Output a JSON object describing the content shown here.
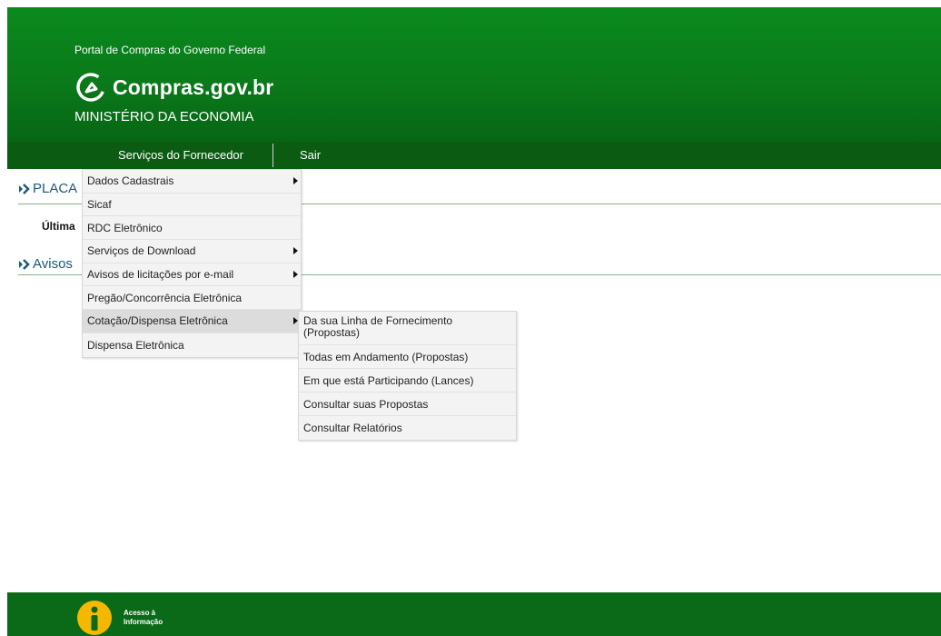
{
  "header": {
    "portal_name": "Portal de Compras do Governo Federal",
    "brand": "Compras.gov.br",
    "ministry": "MINISTÉRIO DA ECONOMIA",
    "logo_icon": "compras-logo-icon"
  },
  "nav": {
    "services": "Serviços do Fornecedor",
    "exit": "Sair"
  },
  "sections": {
    "placa": "PLACA",
    "ultima": "Última",
    "avisos": "Avisos"
  },
  "menu": {
    "items": [
      {
        "label": "Dados Cadastrais",
        "submenu": true
      },
      {
        "label": "Sicaf",
        "submenu": false
      },
      {
        "label": "RDC Eletrônico",
        "submenu": false
      },
      {
        "label": "Serviços de Download",
        "submenu": true
      },
      {
        "label": "Avisos de licitações por e-mail",
        "submenu": true
      },
      {
        "label": "Pregão/Concorrência Eletrônica",
        "submenu": false
      },
      {
        "label": "Cotação/Dispensa Eletrônica",
        "submenu": true,
        "active": true
      },
      {
        "label": "Dispensa Eletrônica",
        "submenu": false
      }
    ]
  },
  "submenu": {
    "items": [
      {
        "label": "Da sua Linha de Fornecimento (Propostas)"
      },
      {
        "label": "Todas em Andamento (Propostas)"
      },
      {
        "label": "Em que está Participando (Lances)"
      },
      {
        "label": "Consultar suas Propostas"
      },
      {
        "label": "Consultar Relatórios"
      }
    ]
  },
  "footer": {
    "access_line1": "Acesso à",
    "access_line2": "Informação",
    "icon": "info-icon"
  },
  "colors": {
    "header_green": "#0a7a1a",
    "nav_green": "#0b5b12",
    "footer_green": "#0a6a18",
    "info_yellow": "#f5b800"
  }
}
